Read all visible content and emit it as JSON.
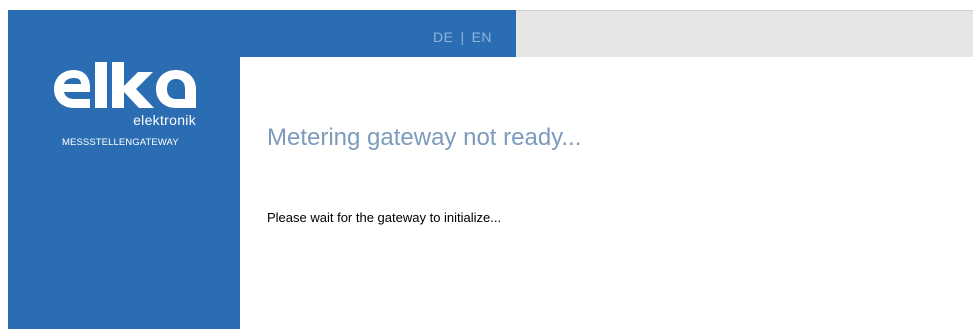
{
  "header": {
    "lang_de": "DE",
    "lang_sep": "|",
    "lang_en": "EN"
  },
  "sidebar": {
    "logo_text": "elka",
    "logo_subtext": "elektronik",
    "product_name": "MESSSTELLENGATEWAY"
  },
  "main": {
    "title": "Metering gateway not ready...",
    "message": "Please wait for the gateway to initialize..."
  },
  "colors": {
    "brand_blue": "#2a6db2",
    "title_blue": "#7c9bbd",
    "header_grey": "#e6e6e6"
  }
}
